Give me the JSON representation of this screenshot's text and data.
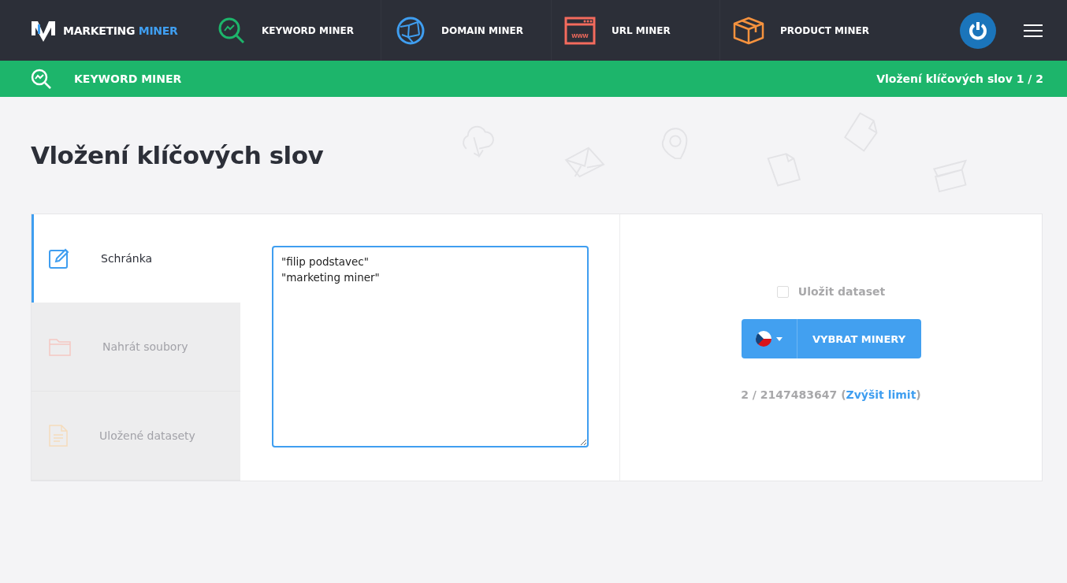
{
  "brand": {
    "word_1": "MARKETING",
    "word_2": "MINER"
  },
  "nav": [
    {
      "label": "KEYWORD MINER",
      "kind": "keyword"
    },
    {
      "label": "DOMAIN MINER",
      "kind": "domain"
    },
    {
      "label": "URL MINER",
      "kind": "url",
      "icon_text": "www"
    },
    {
      "label": "PRODUCT MINER",
      "kind": "product"
    }
  ],
  "subbar": {
    "title": "KEYWORD MINER",
    "step": "Vložení klíčových slov 1 / 2"
  },
  "page_title": "Vložení klíčových slov",
  "sources": [
    {
      "label": "Schránka",
      "kind": "clipboard",
      "selected": true
    },
    {
      "label": "Nahrát soubory",
      "kind": "upload",
      "selected": false
    },
    {
      "label": "Uložené datasety",
      "kind": "datasets",
      "selected": false
    }
  ],
  "keywords_input": {
    "value": "\"filip podstavec\"\n\"marketing miner\""
  },
  "save_dataset": {
    "label": "Uložit dataset",
    "checked": false
  },
  "submit": {
    "label": "VYBRAT MINERY"
  },
  "limit": {
    "count": "2 / 2147483647",
    "open": "(",
    "link": "Zvýšit limit",
    "close": ")"
  }
}
